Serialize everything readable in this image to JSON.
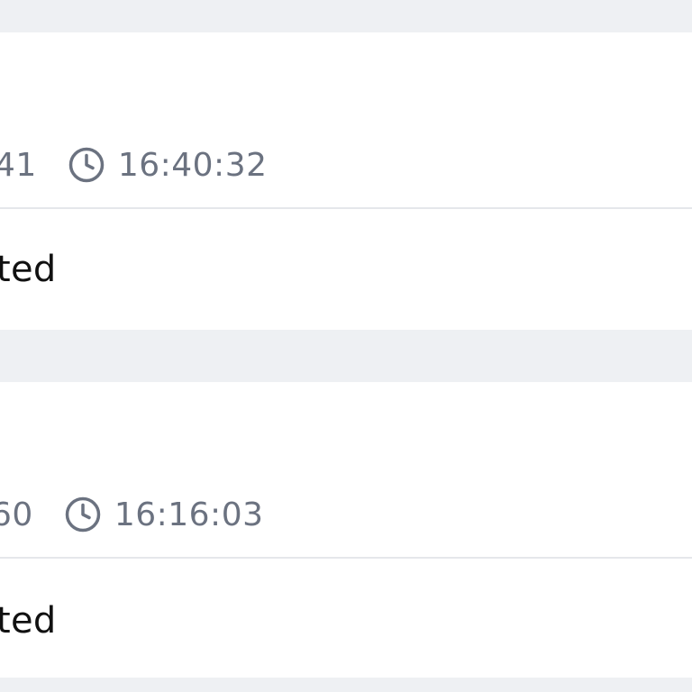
{
  "items": [
    {
      "id_fragment": "41",
      "time": "16:40:32",
      "status_fragment": "ted"
    },
    {
      "id_fragment": "60",
      "time": "16:16:03",
      "status_fragment": "ted"
    }
  ],
  "icons": {
    "time_icon": "clock-icon"
  },
  "colors": {
    "page_background": "#eef0f3",
    "card_background": "#ffffff",
    "meta_text": "#6b7280",
    "status_text": "#111111",
    "divider": "#e5e7eb"
  }
}
